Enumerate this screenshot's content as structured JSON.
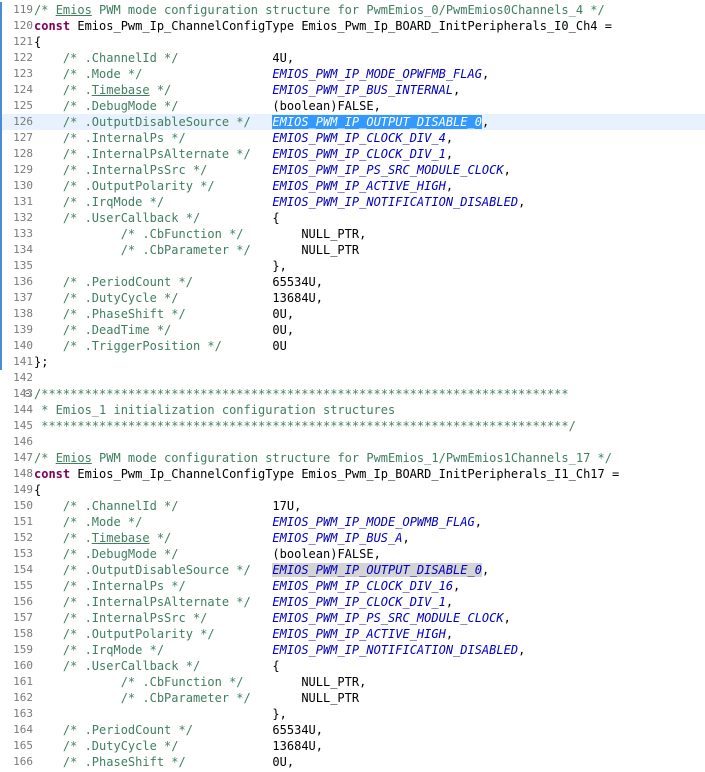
{
  "lines": [
    {
      "num": "119",
      "segs": [
        {
          "t": "/* ",
          "c": "cmt"
        },
        {
          "t": "Emios",
          "c": "cmtund"
        },
        {
          "t": " PWM mode configuration structure for PwmEmios_0/PwmEmios0Channels_4 */",
          "c": "cmt"
        }
      ]
    },
    {
      "num": "120",
      "segs": [
        {
          "t": "const",
          "c": "kw"
        },
        {
          "t": " Emios_Pwm_Ip_ChannelConfigType Emios_Pwm_Ip_BOARD_InitPeripherals_I0_Ch4 =",
          "c": "txt"
        }
      ]
    },
    {
      "num": "121",
      "segs": [
        {
          "t": "{",
          "c": "txt"
        }
      ]
    },
    {
      "num": "122",
      "segs": [
        {
          "t": "    /* .ChannelId */             ",
          "c": "cmt"
        },
        {
          "t": "4U,",
          "c": "txt"
        }
      ]
    },
    {
      "num": "123",
      "segs": [
        {
          "t": "    /* .Mode */                  ",
          "c": "cmt"
        },
        {
          "t": "EMIOS_PWM_IP_MODE_OPWFMB_FLAG",
          "c": "mac"
        },
        {
          "t": ",",
          "c": "txt"
        }
      ]
    },
    {
      "num": "124",
      "segs": [
        {
          "t": "    /* .",
          "c": "cmt"
        },
        {
          "t": "Timebase",
          "c": "cmtund"
        },
        {
          "t": " */              ",
          "c": "cmt"
        },
        {
          "t": "EMIOS_PWM_IP_BUS_INTERNAL",
          "c": "mac"
        },
        {
          "t": ",",
          "c": "txt"
        }
      ]
    },
    {
      "num": "125",
      "segs": [
        {
          "t": "    /* .DebugMode */             ",
          "c": "cmt"
        },
        {
          "t": "(boolean)FALSE,",
          "c": "txt"
        }
      ]
    },
    {
      "num": "126",
      "current": true,
      "segs": [
        {
          "t": "    /* .OutputDisableSource */   ",
          "c": "cmt"
        },
        {
          "t": "EMIOS_PWM_IP_OUTPUT_DISABLE_0",
          "c": "sel"
        },
        {
          "t": ",",
          "c": "txt"
        }
      ]
    },
    {
      "num": "127",
      "segs": [
        {
          "t": "    /* .InternalPs */            ",
          "c": "cmt"
        },
        {
          "t": "EMIOS_PWM_IP_CLOCK_DIV_4",
          "c": "mac"
        },
        {
          "t": ",",
          "c": "txt"
        }
      ]
    },
    {
      "num": "128",
      "segs": [
        {
          "t": "    /* .InternalPsAlternate */   ",
          "c": "cmt"
        },
        {
          "t": "EMIOS_PWM_IP_CLOCK_DIV_1",
          "c": "mac"
        },
        {
          "t": ",",
          "c": "txt"
        }
      ]
    },
    {
      "num": "129",
      "segs": [
        {
          "t": "    /* .InternalPsSrc */         ",
          "c": "cmt"
        },
        {
          "t": "EMIOS_PWM_IP_PS_SRC_MODULE_CLOCK",
          "c": "mac"
        },
        {
          "t": ",",
          "c": "txt"
        }
      ]
    },
    {
      "num": "130",
      "segs": [
        {
          "t": "    /* .OutputPolarity */        ",
          "c": "cmt"
        },
        {
          "t": "EMIOS_PWM_IP_ACTIVE_HIGH",
          "c": "mac"
        },
        {
          "t": ",",
          "c": "txt"
        }
      ]
    },
    {
      "num": "131",
      "segs": [
        {
          "t": "    /* .IrqMode */               ",
          "c": "cmt"
        },
        {
          "t": "EMIOS_PWM_IP_NOTIFICATION_DISABLED",
          "c": "mac"
        },
        {
          "t": ",",
          "c": "txt"
        }
      ]
    },
    {
      "num": "132",
      "segs": [
        {
          "t": "    /* .UserCallback */          ",
          "c": "cmt"
        },
        {
          "t": "{",
          "c": "txt"
        }
      ]
    },
    {
      "num": "133",
      "segs": [
        {
          "t": "            /* .CbFunction */        ",
          "c": "cmt"
        },
        {
          "t": "NULL_PTR,",
          "c": "txt"
        }
      ]
    },
    {
      "num": "134",
      "segs": [
        {
          "t": "            /* .CbParameter */       ",
          "c": "cmt"
        },
        {
          "t": "NULL_PTR",
          "c": "txt"
        }
      ]
    },
    {
      "num": "135",
      "segs": [
        {
          "t": "                                 },",
          "c": "txt"
        }
      ]
    },
    {
      "num": "136",
      "segs": [
        {
          "t": "    /* .PeriodCount */           ",
          "c": "cmt"
        },
        {
          "t": "65534U,",
          "c": "txt"
        }
      ]
    },
    {
      "num": "137",
      "segs": [
        {
          "t": "    /* .DutyCycle */             ",
          "c": "cmt"
        },
        {
          "t": "13684U,",
          "c": "txt"
        }
      ]
    },
    {
      "num": "138",
      "segs": [
        {
          "t": "    /* .PhaseShift */            ",
          "c": "cmt"
        },
        {
          "t": "0U,",
          "c": "txt"
        }
      ]
    },
    {
      "num": "139",
      "segs": [
        {
          "t": "    /* .DeadTime */              ",
          "c": "cmt"
        },
        {
          "t": "0U,",
          "c": "txt"
        }
      ]
    },
    {
      "num": "140",
      "segs": [
        {
          "t": "    /* .TriggerPosition */       ",
          "c": "cmt"
        },
        {
          "t": "0U",
          "c": "txt"
        }
      ]
    },
    {
      "num": "141",
      "segs": [
        {
          "t": "};",
          "c": "txt"
        }
      ]
    },
    {
      "num": "142",
      "segs": []
    },
    {
      "num": "143",
      "fold": true,
      "segs": [
        {
          "t": "/*************************************************************************",
          "c": "cmt"
        }
      ]
    },
    {
      "num": "144",
      "segs": [
        {
          "t": " * Emios_1 initialization configuration structures",
          "c": "cmt"
        }
      ]
    },
    {
      "num": "145",
      "segs": [
        {
          "t": " *************************************************************************/",
          "c": "cmt"
        }
      ]
    },
    {
      "num": "146",
      "segs": []
    },
    {
      "num": "147",
      "segs": [
        {
          "t": "/* ",
          "c": "cmt"
        },
        {
          "t": "Emios",
          "c": "cmtund"
        },
        {
          "t": " PWM mode configuration structure for PwmEmios_1/PwmEmios1Channels_17 */",
          "c": "cmt"
        }
      ]
    },
    {
      "num": "148",
      "segs": [
        {
          "t": "const",
          "c": "kw"
        },
        {
          "t": " Emios_Pwm_Ip_ChannelConfigType Emios_Pwm_Ip_BOARD_InitPeripherals_I1_Ch17 =",
          "c": "txt"
        }
      ]
    },
    {
      "num": "149",
      "segs": [
        {
          "t": "{",
          "c": "txt"
        }
      ]
    },
    {
      "num": "150",
      "segs": [
        {
          "t": "    /* .ChannelId */             ",
          "c": "cmt"
        },
        {
          "t": "17U,",
          "c": "txt"
        }
      ]
    },
    {
      "num": "151",
      "segs": [
        {
          "t": "    /* .Mode */                  ",
          "c": "cmt"
        },
        {
          "t": "EMIOS_PWM_IP_MODE_OPWMB_FLAG",
          "c": "mac"
        },
        {
          "t": ",",
          "c": "txt"
        }
      ]
    },
    {
      "num": "152",
      "segs": [
        {
          "t": "    /* .",
          "c": "cmt"
        },
        {
          "t": "Timebase",
          "c": "cmtund"
        },
        {
          "t": " */              ",
          "c": "cmt"
        },
        {
          "t": "EMIOS_PWM_IP_BUS_A",
          "c": "mac"
        },
        {
          "t": ",",
          "c": "txt"
        }
      ]
    },
    {
      "num": "153",
      "segs": [
        {
          "t": "    /* .DebugMode */             ",
          "c": "cmt"
        },
        {
          "t": "(boolean)FALSE,",
          "c": "txt"
        }
      ]
    },
    {
      "num": "154",
      "segs": [
        {
          "t": "    /* .OutputDisableSource */   ",
          "c": "cmt"
        },
        {
          "t": "EMIOS_PWM_IP_OUTPUT_DISABLE_0",
          "c": "occ"
        },
        {
          "t": ",",
          "c": "txt"
        }
      ]
    },
    {
      "num": "155",
      "segs": [
        {
          "t": "    /* .InternalPs */            ",
          "c": "cmt"
        },
        {
          "t": "EMIOS_PWM_IP_CLOCK_DIV_16",
          "c": "mac"
        },
        {
          "t": ",",
          "c": "txt"
        }
      ]
    },
    {
      "num": "156",
      "segs": [
        {
          "t": "    /* .InternalPsAlternate */   ",
          "c": "cmt"
        },
        {
          "t": "EMIOS_PWM_IP_CLOCK_DIV_1",
          "c": "mac"
        },
        {
          "t": ",",
          "c": "txt"
        }
      ]
    },
    {
      "num": "157",
      "segs": [
        {
          "t": "    /* .InternalPsSrc */         ",
          "c": "cmt"
        },
        {
          "t": "EMIOS_PWM_IP_PS_SRC_MODULE_CLOCK",
          "c": "mac"
        },
        {
          "t": ",",
          "c": "txt"
        }
      ]
    },
    {
      "num": "158",
      "segs": [
        {
          "t": "    /* .OutputPolarity */        ",
          "c": "cmt"
        },
        {
          "t": "EMIOS_PWM_IP_ACTIVE_HIGH",
          "c": "mac"
        },
        {
          "t": ",",
          "c": "txt"
        }
      ]
    },
    {
      "num": "159",
      "segs": [
        {
          "t": "    /* .IrqMode */               ",
          "c": "cmt"
        },
        {
          "t": "EMIOS_PWM_IP_NOTIFICATION_DISABLED",
          "c": "mac"
        },
        {
          "t": ",",
          "c": "txt"
        }
      ]
    },
    {
      "num": "160",
      "segs": [
        {
          "t": "    /* .UserCallback */          ",
          "c": "cmt"
        },
        {
          "t": "{",
          "c": "txt"
        }
      ]
    },
    {
      "num": "161",
      "segs": [
        {
          "t": "            /* .CbFunction */        ",
          "c": "cmt"
        },
        {
          "t": "NULL_PTR,",
          "c": "txt"
        }
      ]
    },
    {
      "num": "162",
      "segs": [
        {
          "t": "            /* .CbParameter */       ",
          "c": "cmt"
        },
        {
          "t": "NULL_PTR",
          "c": "txt"
        }
      ]
    },
    {
      "num": "163",
      "segs": [
        {
          "t": "                                 },",
          "c": "txt"
        }
      ]
    },
    {
      "num": "164",
      "segs": [
        {
          "t": "    /* .PeriodCount */           ",
          "c": "cmt"
        },
        {
          "t": "65534U,",
          "c": "txt"
        }
      ]
    },
    {
      "num": "165",
      "segs": [
        {
          "t": "    /* .DutyCycle */             ",
          "c": "cmt"
        },
        {
          "t": "13684U,",
          "c": "txt"
        }
      ]
    },
    {
      "num": "166",
      "segs": [
        {
          "t": "    /* .PhaseShift */            ",
          "c": "cmt"
        },
        {
          "t": "0U,",
          "c": "txt"
        }
      ]
    }
  ],
  "colors": {
    "comment": "#3f7f5f",
    "keyword": "#7f0055",
    "macro": "#0000c0",
    "selection": "#3399ff",
    "occurrence": "#d4d4d4",
    "current_line": "#e8f2fe",
    "fold_bar": "#4b8ad6"
  }
}
